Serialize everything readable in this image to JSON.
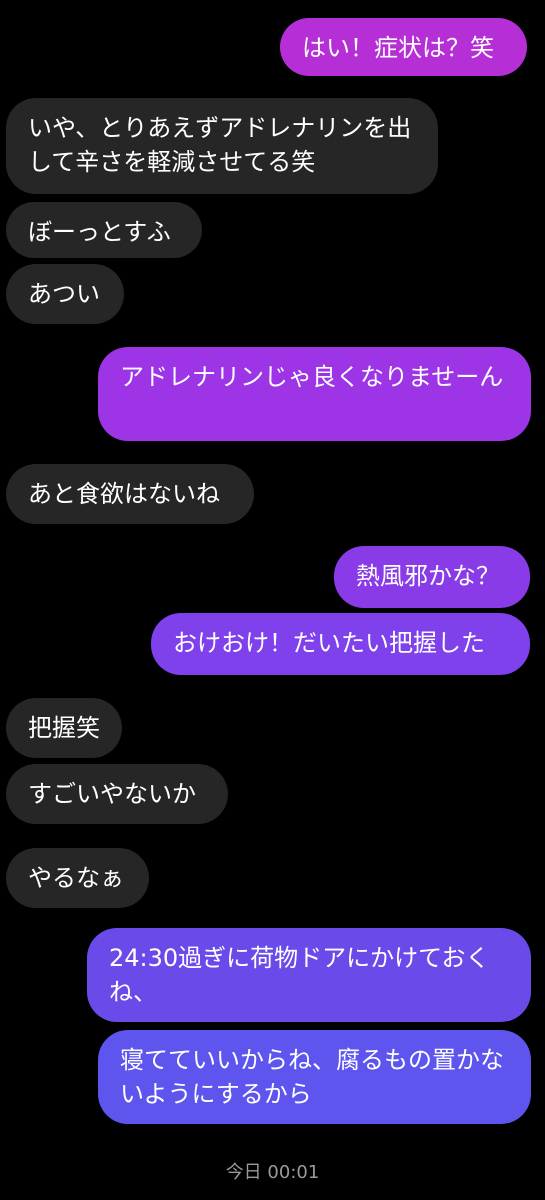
{
  "header": {
    "fragment": ""
  },
  "messages": [
    {
      "id": "m1",
      "side": "out",
      "text": "はい！症状は？笑"
    },
    {
      "id": "m2",
      "side": "in",
      "text": "いや、とりあえずアドレナリンを出して辛さを軽減させてる笑"
    },
    {
      "id": "m3",
      "side": "in",
      "text": "ぼーっとすふ"
    },
    {
      "id": "m4",
      "side": "in",
      "text": "あつい"
    },
    {
      "id": "m5",
      "side": "out",
      "text": "アドレナリンじゃ良くなりませーん"
    },
    {
      "id": "m6",
      "side": "in",
      "text": "あと食欲はないね"
    },
    {
      "id": "m7",
      "side": "out",
      "text": "熱風邪かな？"
    },
    {
      "id": "m8",
      "side": "out",
      "text": "おけおけ！だいたい把握した"
    },
    {
      "id": "m9",
      "side": "in",
      "text": "把握笑"
    },
    {
      "id": "m10",
      "side": "in",
      "text": "すごいやないか"
    },
    {
      "id": "m11",
      "side": "in",
      "text": "やるなぁ"
    },
    {
      "id": "m12",
      "side": "out",
      "text": "24:30過ぎに荷物ドアにかけておくね、"
    },
    {
      "id": "m13",
      "side": "out",
      "text": "寝てていいからね、腐るもの置かないようにするから"
    }
  ],
  "timestamp": "今日 00:01",
  "colors": {
    "incoming": "#262626",
    "outgoing_1": "#b62fd6",
    "outgoing_2": "#9d34e6",
    "outgoing_3": "#7d3fec",
    "outgoing_4": "#6a4be9",
    "outgoing_5": "#5d55ee"
  }
}
